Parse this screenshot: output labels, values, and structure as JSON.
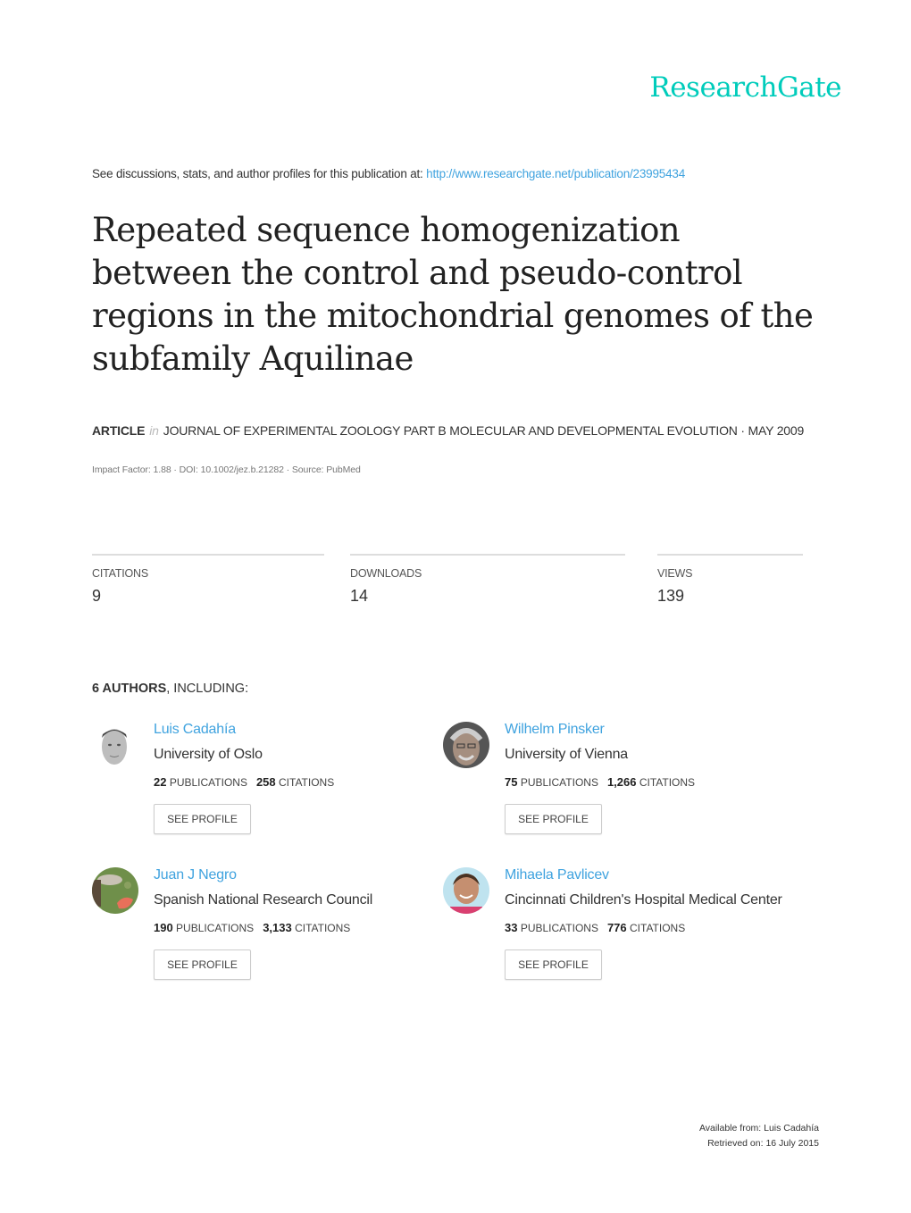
{
  "brand": {
    "logo_text": "ResearchGate",
    "accent_color": "#00ccbb",
    "link_color": "#40a3df"
  },
  "header": {
    "discussion_text": "See discussions, stats, and author profiles for this publication at: ",
    "publication_url": "http://www.researchgate.net/publication/23995434"
  },
  "article": {
    "title": "Repeated sequence homogenization between the control and pseudo-control regions in the mitochondrial genomes of the subfamily Aquilinae",
    "type": "ARTICLE",
    "in_label": "in",
    "journal": "JOURNAL OF EXPERIMENTAL ZOOLOGY PART B MOLECULAR AND DEVELOPMENTAL EVOLUTION · MAY 2009",
    "submeta": "Impact Factor: 1.88 · DOI: 10.1002/jez.b.21282 · Source: PubMed"
  },
  "stats": [
    {
      "label": "CITATIONS",
      "value": "9"
    },
    {
      "label": "DOWNLOADS",
      "value": "14"
    },
    {
      "label": "VIEWS",
      "value": "139"
    }
  ],
  "authors_header": {
    "count_label": "6 AUTHORS",
    "suffix": ", INCLUDING:"
  },
  "authors": [
    {
      "name": "Luis Cadahía",
      "institution": "University of Oslo",
      "publications": "22",
      "publications_label": "PUBLICATIONS",
      "citations": "258",
      "citations_label": "CITATIONS",
      "button": "SEE PROFILE"
    },
    {
      "name": "Wilhelm Pinsker",
      "institution": "University of Vienna",
      "publications": "75",
      "publications_label": "PUBLICATIONS",
      "citations": "1,266",
      "citations_label": "CITATIONS",
      "button": "SEE PROFILE"
    },
    {
      "name": "Juan J Negro",
      "institution": "Spanish National Research Council",
      "publications": "190",
      "publications_label": "PUBLICATIONS",
      "citations": "3,133",
      "citations_label": "CITATIONS",
      "button": "SEE PROFILE"
    },
    {
      "name": "Mihaela Pavlicev",
      "institution": "Cincinnati Children's Hospital Medical Center",
      "publications": "33",
      "publications_label": "PUBLICATIONS",
      "citations": "776",
      "citations_label": "CITATIONS",
      "button": "SEE PROFILE"
    }
  ],
  "footer": {
    "available_from": "Available from: Luis Cadahía",
    "retrieved_on": "Retrieved on: 16 July 2015"
  }
}
